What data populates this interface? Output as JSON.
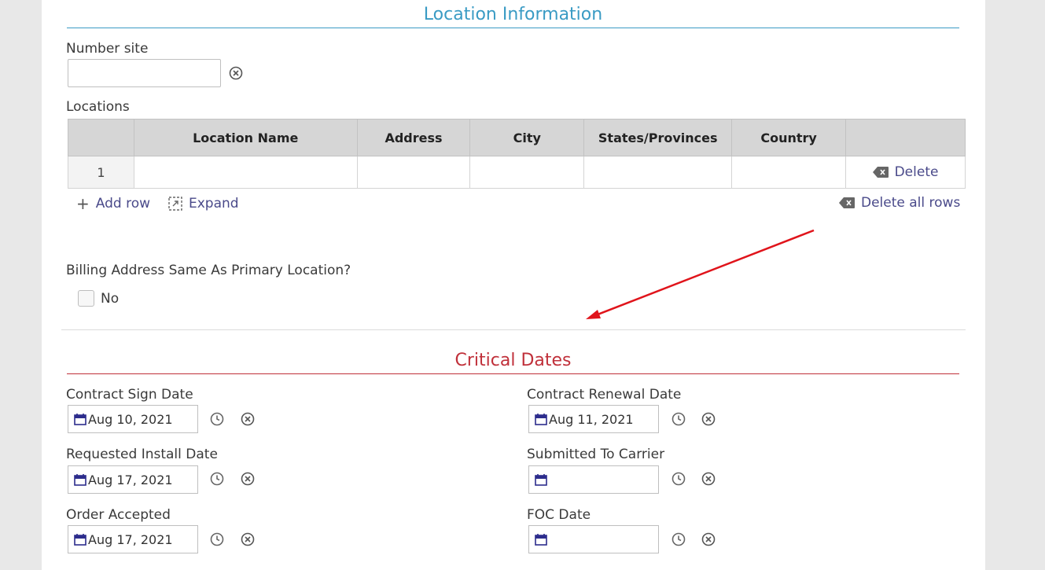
{
  "location_section": {
    "title": "Location Information",
    "title_color": "#3a9bc4",
    "number_site": {
      "label": "Number site",
      "value": ""
    },
    "locations": {
      "label": "Locations",
      "columns": [
        "",
        "Location Name",
        "Address",
        "City",
        "States/Provinces",
        "Country",
        ""
      ],
      "rows": [
        {
          "index": "1",
          "location_name": "",
          "address": "",
          "city": "",
          "state": "",
          "country": "",
          "delete_label": "Delete"
        }
      ],
      "add_row_label": "Add row",
      "expand_label": "Expand",
      "delete_all_label": "Delete all rows"
    },
    "billing": {
      "label": "Billing Address Same As Primary Location?",
      "checkbox_label": "No",
      "checked": false
    }
  },
  "dates_section": {
    "title": "Critical Dates",
    "title_color": "#c0303a",
    "fields": {
      "contract_sign": {
        "label": "Contract Sign Date",
        "value": "Aug 10, 2021"
      },
      "contract_renewal": {
        "label": "Contract Renewal Date",
        "value": "Aug 11, 2021"
      },
      "requested_install": {
        "label": "Requested Install Date",
        "value": "Aug 17, 2021"
      },
      "submitted_carrier": {
        "label": "Submitted To Carrier",
        "value": ""
      },
      "order_accepted": {
        "label": "Order Accepted",
        "value": "Aug 17, 2021"
      },
      "foc_date": {
        "label": "FOC Date",
        "value": ""
      }
    }
  },
  "colors": {
    "link": "#4a4a8a",
    "annotation_arrow": "#e0141b",
    "calendar_icon": "#2c2c8c"
  }
}
